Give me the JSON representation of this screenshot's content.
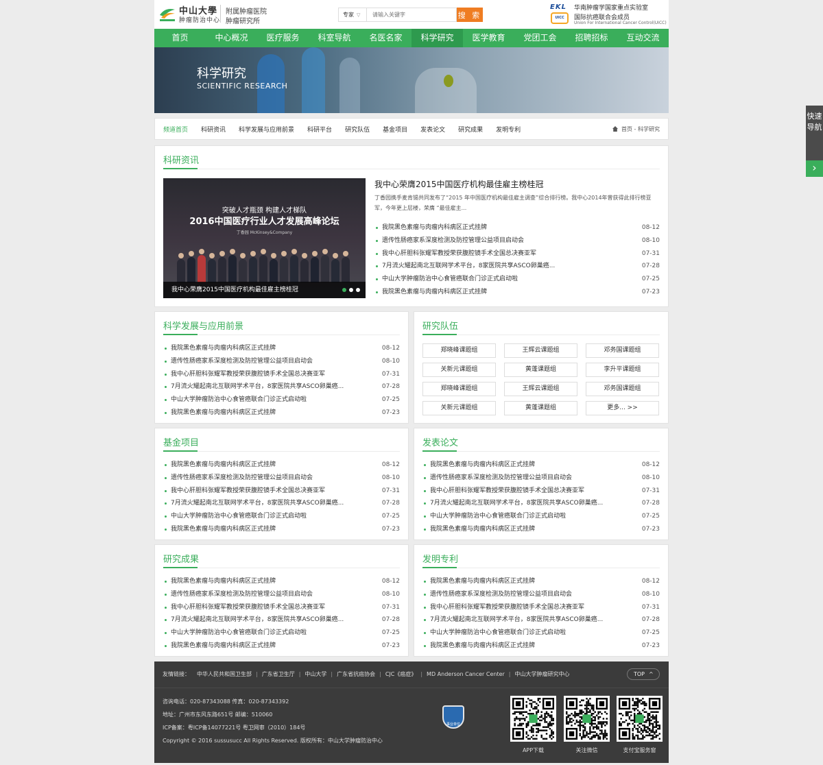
{
  "header": {
    "logo_cn": "中山大學",
    "logo_sub": "肿瘤防治中心",
    "hospital_line1": "附属肿瘤医院",
    "hospital_line2": "肿瘤研究所",
    "search_type": "专家",
    "search_placeholder": "请输入关键字",
    "search_button": "搜 索",
    "ekl_logo": "EKL",
    "ekl_text": "华南肿瘤学国家重点实验室",
    "uicc_logo": "UICC",
    "uicc_cn": "国际抗癌联合会成员",
    "uicc_en": "Union For International Cancer Control(UICC)"
  },
  "nav": [
    "首页",
    "中心概况",
    "医疗服务",
    "科室导航",
    "名医名家",
    "科学研究",
    "医学教育",
    "党团工会",
    "招聘招标",
    "互动交流"
  ],
  "banner": {
    "title": "科学研究",
    "subtitle": "SCIENTIFIC RESEARCH"
  },
  "subnav": {
    "items": [
      "频道首页",
      "科研资讯",
      "科学发展与应用前景",
      "科研平台",
      "研究队伍",
      "基金项目",
      "发表论文",
      "研究成果",
      "发明专利"
    ],
    "breadcrumb": "首页 - 科学研究"
  },
  "news": {
    "title": "科研资讯",
    "image_line1": "突破人才瓶颈  构建人才梯队",
    "image_line2": "2016中国医疗行业人才发展高峰论坛",
    "image_line3": "丁香园    McKinsey&Company",
    "image_caption": "我中心荣膺2015中国医疗机构最佳雇主榜桂冠",
    "headline": "我中心荣膺2015中国医疗机构最佳雇主榜桂冠",
    "summary": "丁香园携手麦肯锡共同发布了“2015 年中国医疗机构最佳雇主调查”综合排行榜。我中心2014年曾获得此排行榜亚军，今年更上层楼，荣膺 “最佳雇主...",
    "items": [
      {
        "t": "我院黑色素瘤与肉瘤内科病区正式挂牌",
        "d": "08-12"
      },
      {
        "t": "遗传性肠癌家系深度检测及防控管理公益项目启动会",
        "d": "08-10"
      },
      {
        "t": "我中心肝胆科张耀军教授荣获腹腔镜手术全国总决赛亚军",
        "d": "07-31"
      },
      {
        "t": "7月流火耀起南北互联网学术平台，8家医院共享ASCO卵巢癌...",
        "d": "07-28"
      },
      {
        "t": "中山大学肿瘤防治中心食管癌联合门诊正式启动啦",
        "d": "07-25"
      },
      {
        "t": "我院黑色素瘤与肉瘤内科病区正式挂牌",
        "d": "07-23"
      }
    ]
  },
  "list_items": [
    {
      "t": "我院黑色素瘤与肉瘤内科病区正式挂牌",
      "d": "08-12"
    },
    {
      "t": "遗传性肠癌家系深度检测及防控管理公益项目启动会",
      "d": "08-10"
    },
    {
      "t": "我中心肝胆科张耀军教授荣获腹腔镜手术全国总决赛亚军",
      "d": "07-31"
    },
    {
      "t": "7月流火耀起南北互联网学术平台，8家医院共享ASCO卵巢癌...",
      "d": "07-28"
    },
    {
      "t": "中山大学肿瘤防治中心食管癌联合门诊正式启动啦",
      "d": "07-25"
    },
    {
      "t": "我院黑色素瘤与肉瘤内科病区正式挂牌",
      "d": "07-23"
    }
  ],
  "panels": {
    "science": "科学发展与应用前景",
    "team": "研究队伍",
    "fund": "基金项目",
    "papers": "发表论文",
    "results": "研究成果",
    "patents": "发明专利"
  },
  "team_groups": [
    "郑晓峰课题组",
    "王辉云课题组",
    "邓务国课题组",
    "关新元课题组",
    "黄蓬课题组",
    "李升平课题组",
    "郑晓峰课题组",
    "王辉云课题组",
    "邓务国课题组",
    "关新元课题组",
    "黄蓬课题组",
    "更多... >>"
  ],
  "footer": {
    "links_label": "友情链接：",
    "links": [
      "中华人民共和国卫生部",
      "广东省卫生厅",
      "中山大学",
      "广东省抗癌协会",
      "CJC《癌症》",
      "MD Anderson Cancer Center",
      "中山大学肿瘤研究中心"
    ],
    "top": "TOP",
    "phone": "咨询电话：020-87343088    传真：020-87343392",
    "address": "地址：广州市东风东路651号  邮编：510060",
    "icp": "ICP备案：粤ICP备14077221号    粤卫网审（2010）184号",
    "copyright": "Copyright © 2016 sussusucc All Rights Reserved.    版权所有：中山大学肿瘤防治中心",
    "badge_text": "事业单位",
    "qr_labels": [
      "APP下载",
      "关注微信",
      "支付宝服务窗"
    ]
  },
  "quick_nav": "快速导航",
  "colors": {
    "brand_green": "#3aae5b",
    "search_orange": "#ef7d22",
    "footer_bg": "#3b3b3b"
  }
}
